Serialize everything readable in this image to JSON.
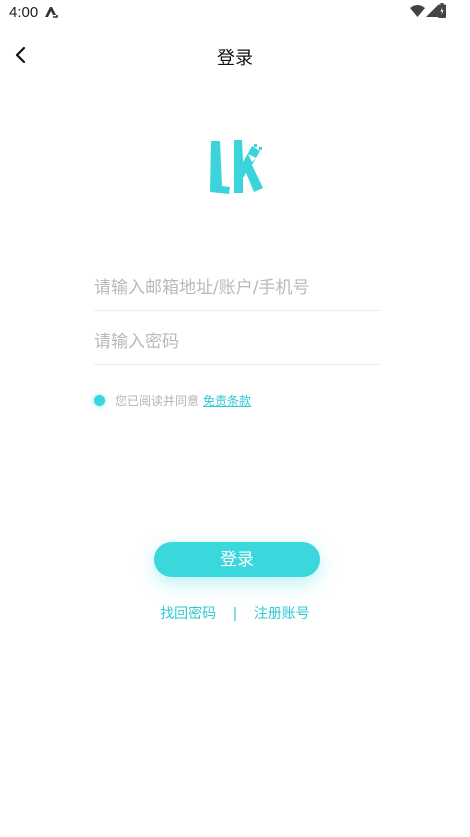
{
  "status_bar": {
    "time": "4:00"
  },
  "header": {
    "title": "登录"
  },
  "form": {
    "account_placeholder": "请输入邮箱地址/账户/手机号",
    "password_placeholder": "请输入密码"
  },
  "agreement": {
    "text": "您已阅读并同意",
    "link": "免责条款"
  },
  "login_button": {
    "label": "登录"
  },
  "links": {
    "recover": "找回密码",
    "separator": "|",
    "register": "注册账号"
  },
  "colors": {
    "accent": "#3ad8dc",
    "link": "#2ec9d2"
  },
  "icons": [
    "back-arrow-icon",
    "app-logo-icon",
    "wifi-icon",
    "signal-icon",
    "battery-icon",
    "status-app-icon"
  ]
}
